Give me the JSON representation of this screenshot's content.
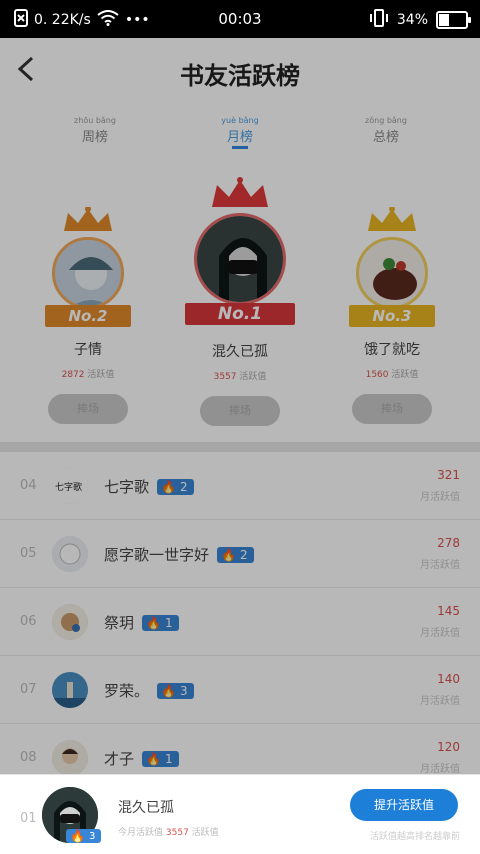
{
  "status_bar": {
    "speed": "0. 22K/s",
    "time": "00:03",
    "battery": "34%",
    "battery_fraction": 0.34
  },
  "header": {
    "title": "书友活跃榜",
    "back_icon": "chevron-left-icon"
  },
  "tabs": [
    {
      "pinyin": "zhōu bǎng",
      "label": "周榜",
      "active": false
    },
    {
      "pinyin": "yuè bǎng",
      "label": "月榜",
      "active": true
    },
    {
      "pinyin": "zǒng bǎng",
      "label": "总榜",
      "active": false
    }
  ],
  "podium": [
    {
      "rank_label": "No.2",
      "name": "子情",
      "score": "2872",
      "score_suffix": "活跃值",
      "button": "捧场",
      "crown_color": "#e08a2a"
    },
    {
      "rank_label": "No.1",
      "name": "混久已孤",
      "score": "3557",
      "score_suffix": "活跃值",
      "button": "捧场",
      "crown_color": "#e03a3a"
    },
    {
      "rank_label": "No.3",
      "name": "饿了就吃",
      "score": "1560",
      "score_suffix": "活跃值",
      "button": "捧场",
      "crown_color": "#e6b422"
    }
  ],
  "list": [
    {
      "rank": "04",
      "name": "七字歌",
      "level": "2",
      "points": "321",
      "sub": "月活跃值"
    },
    {
      "rank": "05",
      "name": "愿字歌一世字好",
      "level": "2",
      "points": "278",
      "sub": "月活跃值"
    },
    {
      "rank": "06",
      "name": "祭玥",
      "level": "1",
      "points": "145",
      "sub": "月活跃值"
    },
    {
      "rank": "07",
      "name": "罗荣。",
      "level": "3",
      "points": "140",
      "sub": "月活跃值"
    },
    {
      "rank": "08",
      "name": "才子",
      "level": "1",
      "points": "120",
      "sub": "月活跃值"
    }
  ],
  "me": {
    "rank": "01",
    "name": "混久已孤",
    "level": "3",
    "score": "3557",
    "meta_prefix": "今月活跃值",
    "meta_suffix": "活跃值",
    "button": "提升活跃值",
    "hint": "活跃值越高排名越靠前"
  },
  "colors": {
    "accent": "#1e7fd9",
    "score_red": "#d9534f"
  }
}
